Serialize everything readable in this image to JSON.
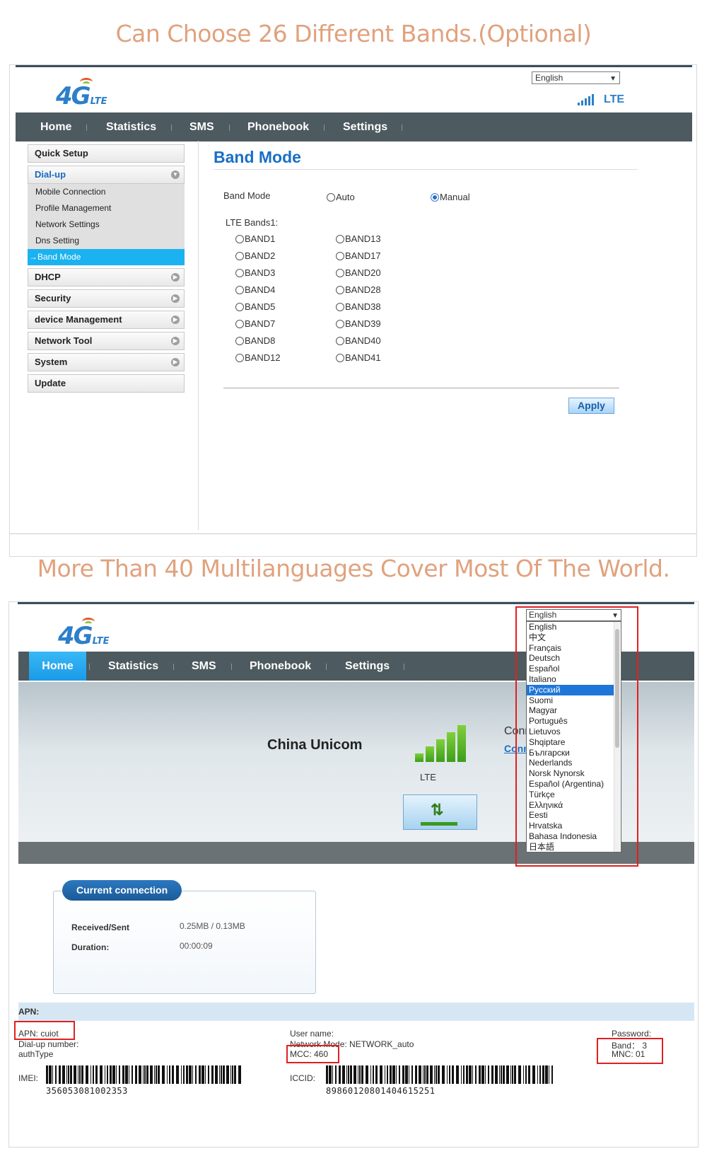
{
  "headline1": "Can Choose 26 Different Bands.(Optional)",
  "headline2": "More Than 40 Multilanguages Cover Most Of The World.",
  "logo": {
    "text": "4G",
    "sub": "LTE"
  },
  "language_selected": "English",
  "signal_label": "LTE",
  "nav": [
    "Home",
    "Statistics",
    "SMS",
    "Phonebook",
    "Settings"
  ],
  "sidebar": {
    "quick_setup": "Quick Setup",
    "dialup": "Dial-up",
    "dialup_sub": [
      "Mobile Connection",
      "Profile Management",
      "Network Settings",
      "Dns Setting"
    ],
    "band_mode_active": "→Band Mode",
    "dhcp": "DHCP",
    "security": "Security",
    "device_mgmt": "device Management",
    "network_tool": "Network Tool",
    "system": "System",
    "update": "Update"
  },
  "band_mode": {
    "title": "Band Mode",
    "mode_label": "Band Mode",
    "auto": "Auto",
    "manual": "Manual",
    "selected": "Manual",
    "lte_bands_label": "LTE Bands1:",
    "bands_col1": [
      "BAND1",
      "BAND2",
      "BAND3",
      "BAND4",
      "BAND5",
      "BAND7",
      "BAND8",
      "BAND12"
    ],
    "bands_col2": [
      "BAND13",
      "BAND17",
      "BAND20",
      "BAND28",
      "BAND38",
      "BAND39",
      "BAND40",
      "BAND41"
    ],
    "apply": "Apply"
  },
  "status": {
    "carrier": "China Unicom",
    "network": "LTE",
    "connected_text": "Connecte",
    "connection_link": "Connectio",
    "current_connection": "Current connection",
    "received_sent_label": "Received/Sent",
    "received_sent_value": "0.25MB /  0.13MB",
    "duration_label": "Duration:",
    "duration_value": "00:00:09"
  },
  "apn": {
    "section": "APN:",
    "apn": "APN: cuiot",
    "dialup_number": "Dial-up number:",
    "auth_type": "authType",
    "user_name": "User name:",
    "network_mode": "Network Mode: NETWORK_auto",
    "mcc": "MCC:  460",
    "password": "Password:",
    "band": "Band：  3",
    "mnc": "MNC:  01",
    "imei_label": "IMEI:",
    "imei": "356053081002353",
    "iccid_label": "ICCID:",
    "iccid": "89860120801404615251"
  },
  "languages": [
    "English",
    "中文",
    "Français",
    "Deutsch",
    "Español",
    "Italiano",
    "Русский",
    "Suomi",
    "Magyar",
    "Português",
    "Lietuvos",
    "Shqiptare",
    "Български",
    "Nederlands",
    "Norsk Nynorsk",
    "Español (Argentina)",
    "Türkçe",
    "Ελληνικά",
    "Eesti",
    "Hrvatska",
    "Bahasa Indonesia",
    "日本語"
  ],
  "language_highlighted": "Русский",
  "colors": {
    "brand_blue": "#1a6fc4",
    "nav_bg": "#4d5a5f",
    "active_cyan": "#1ab2f0",
    "headline": "#e0a27e",
    "highlight_red": "#e02020"
  }
}
